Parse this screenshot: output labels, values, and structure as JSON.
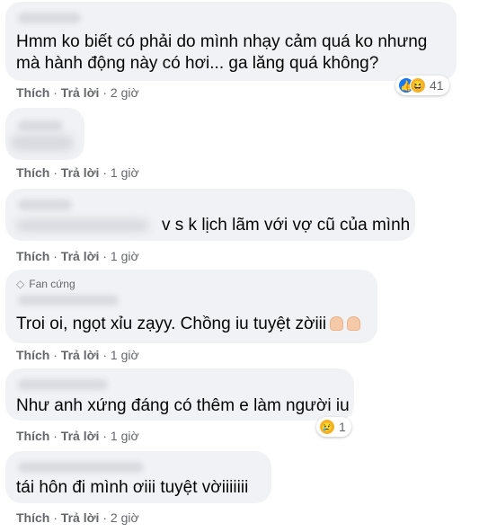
{
  "action_labels": {
    "like": "Thích",
    "reply": "Trả lời",
    "sep": "·"
  },
  "comments": [
    {
      "text_lines": [
        "Hmm ko biết có phải do mình nhạy cảm quá ko nhưng",
        "mà hành động này có hơi... ga lăng quá không?"
      ],
      "time": "2 giờ",
      "reaction_count": "41",
      "reaction_icons": [
        "like-icon",
        "haha-icon"
      ]
    },
    {
      "text_lines": [],
      "time": "1 giờ"
    },
    {
      "text_lines": [
        "v s k lịch lãm với vợ cũ của mình"
      ],
      "time": "1 giờ"
    },
    {
      "badge": "Fan cứng",
      "text_lines": [
        "Troi oi, ngọt xỉu zạyy. Chồng iu tuyệt zờiii"
      ],
      "time": "1 giờ",
      "emoji": "thumbs-up-icon"
    },
    {
      "text_lines": [
        "Như anh xứng đáng có thêm e làm người iu"
      ],
      "time": "1 giờ",
      "reaction_count": "1",
      "reaction_icons": [
        "sad-icon"
      ]
    },
    {
      "text_lines": [
        "tái hôn đi mình ơiii tuyệt vờiiiiiii"
      ],
      "time": "2 giờ"
    }
  ]
}
